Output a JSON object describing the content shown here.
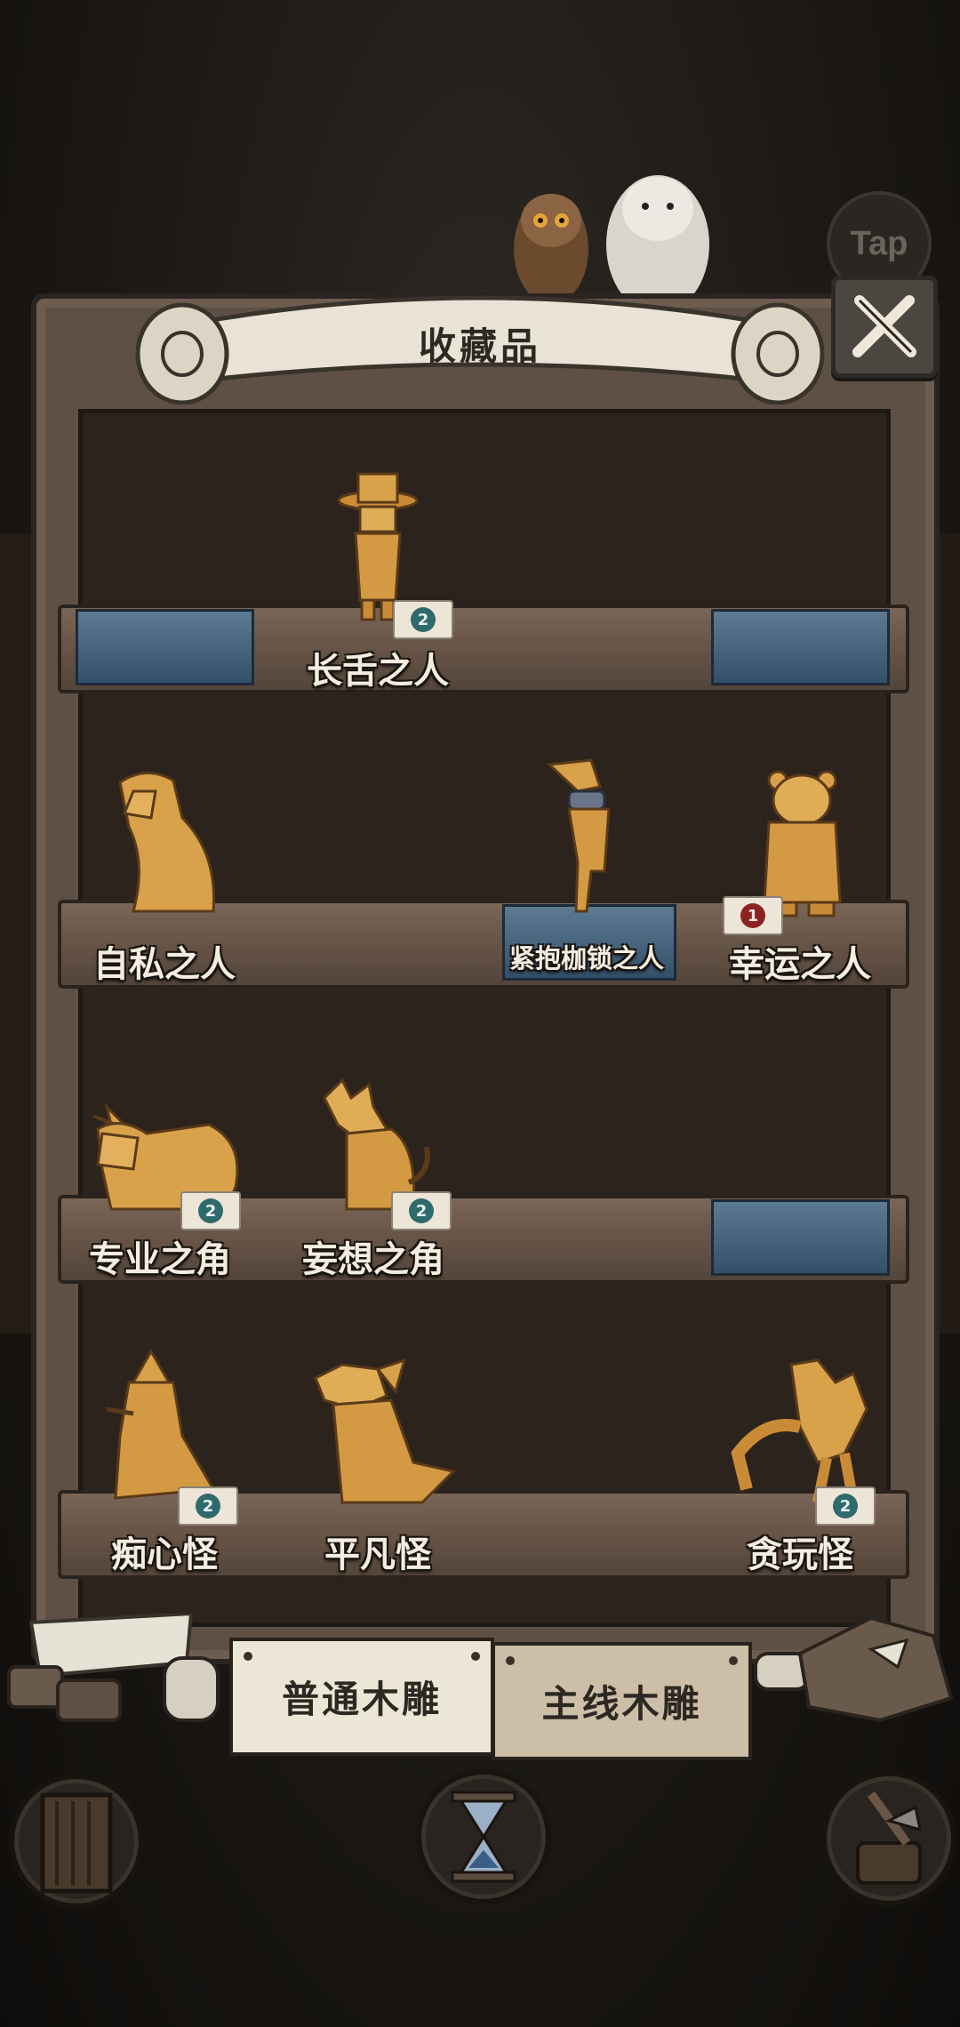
{
  "title": "收藏品",
  "tap_label": "Tap",
  "tabs": {
    "common": "普通木雕",
    "main": "主线木雕"
  },
  "shelves": [
    {
      "items": [
        {
          "name": "长舌之人",
          "count": "2"
        }
      ]
    },
    {
      "items": [
        {
          "name": "自私之人"
        },
        {
          "name": "紧抱枷锁之人"
        },
        {
          "name": "幸运之人",
          "count": "1"
        }
      ]
    },
    {
      "items": [
        {
          "name": "专业之角",
          "count": "2"
        },
        {
          "name": "妄想之角",
          "count": "2"
        }
      ]
    },
    {
      "items": [
        {
          "name": "痴心怪",
          "count": "2"
        },
        {
          "name": "平凡怪"
        },
        {
          "name": "贪玩怪",
          "count": "2"
        }
      ]
    }
  ],
  "icons": {
    "close": "close-x-icon",
    "door": "door-icon",
    "hourglass": "hourglass-icon",
    "axe": "axe-stump-icon"
  },
  "colors": {
    "cloth_blue": "#4a6a86",
    "wood_gold": "#d9a24a",
    "badge_teal": "#2f6a6c",
    "badge_red": "#8d2222"
  }
}
